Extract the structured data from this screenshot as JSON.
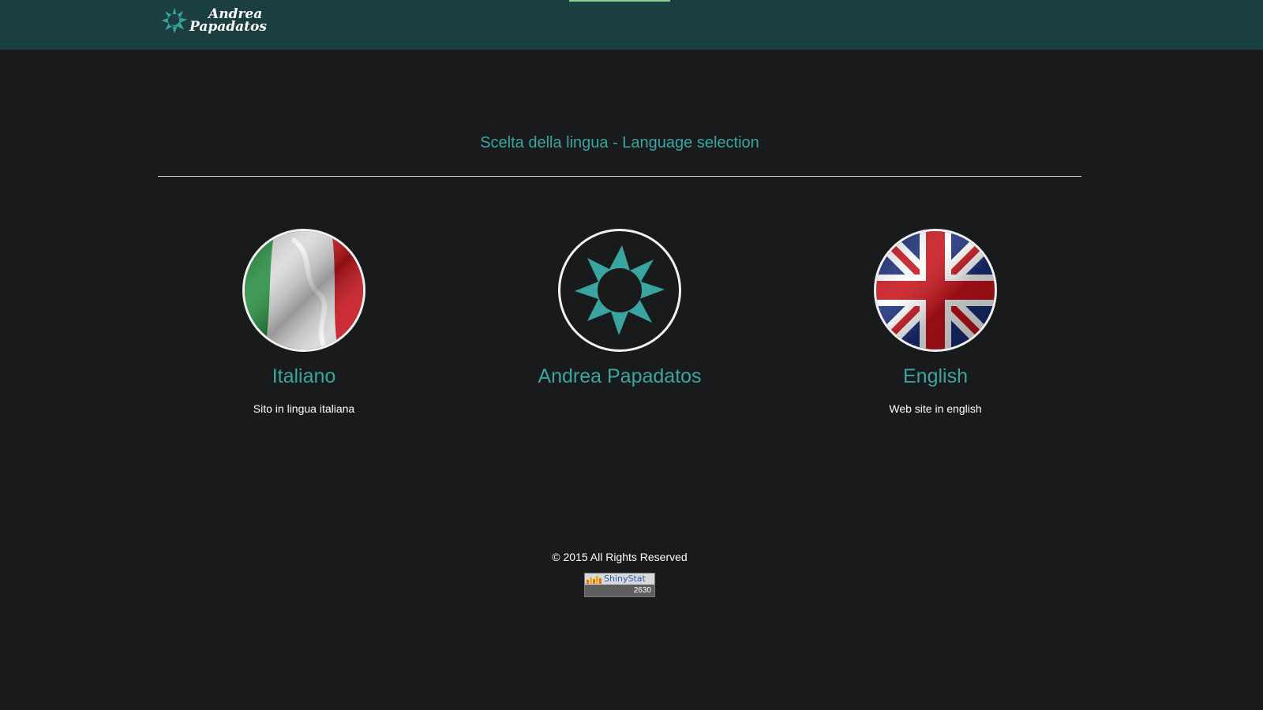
{
  "header": {
    "logo_line1": "Andrea",
    "logo_line2": "Papadatos",
    "accent_color": "#8fcf9a",
    "background_color": "#1b3e40"
  },
  "main": {
    "title": "Scelta della lingua - Language selection",
    "options": [
      {
        "label": "Italiano",
        "subtitle": "Sito in lingua italiana",
        "icon": "italy-flag-icon"
      },
      {
        "label": "Andrea Papadatos",
        "subtitle": "",
        "icon": "sun-moon-logo-icon"
      },
      {
        "label": "English",
        "subtitle": "Web site in english",
        "icon": "uk-flag-icon"
      }
    ],
    "accent_color": "#3aa5a0"
  },
  "footer": {
    "copyright": "© 2015 All Rights Reserved",
    "counter_brand": "ShinyStat",
    "counter_value": "2630"
  }
}
